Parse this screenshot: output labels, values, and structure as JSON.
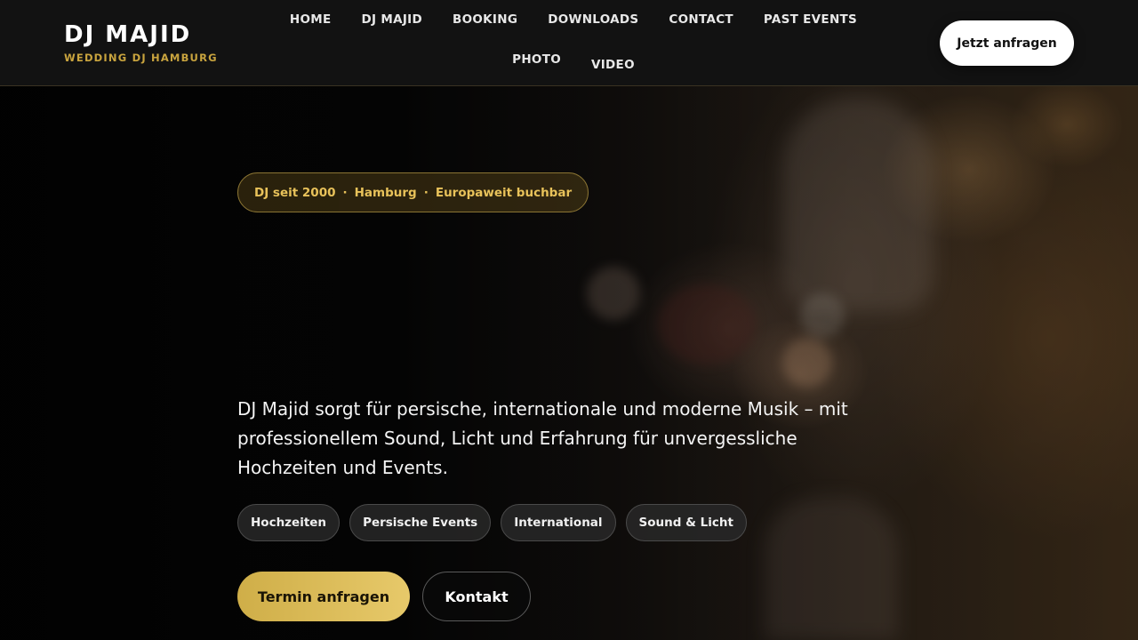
{
  "brand": {
    "title": "DJ MAJID",
    "subtitle": "WEDDING DJ HAMBURG"
  },
  "nav": {
    "items": [
      {
        "label": "HOME"
      },
      {
        "label": "DJ MAJID"
      },
      {
        "label": "BOOKING"
      },
      {
        "label": "DOWNLOADS"
      },
      {
        "label": "CONTACT"
      },
      {
        "label": "PAST EVENTS"
      },
      {
        "label": "PHOTO"
      },
      {
        "label": "VIDEO"
      }
    ]
  },
  "header": {
    "cta_label": "Jetzt anfragen"
  },
  "hero": {
    "badge": {
      "parts": [
        "DJ seit 2000",
        "Hamburg",
        "Europaweit buchbar"
      ],
      "separator": "·"
    },
    "lead": "DJ Majid sorgt für persische, internationale und moderne Musik – mit professionellem Sound, Licht und Erfahrung für unvergessliche Hochzeiten und Events.",
    "tags": [
      "Hochzeiten",
      "Persische Events",
      "International",
      "Sound & Licht"
    ],
    "primary_button": "Termin anfragen",
    "secondary_button": "Kontakt"
  },
  "colors": {
    "accent_gold": "#c9a43e",
    "header_bg": "#121212",
    "button_white": "#ffffff"
  }
}
